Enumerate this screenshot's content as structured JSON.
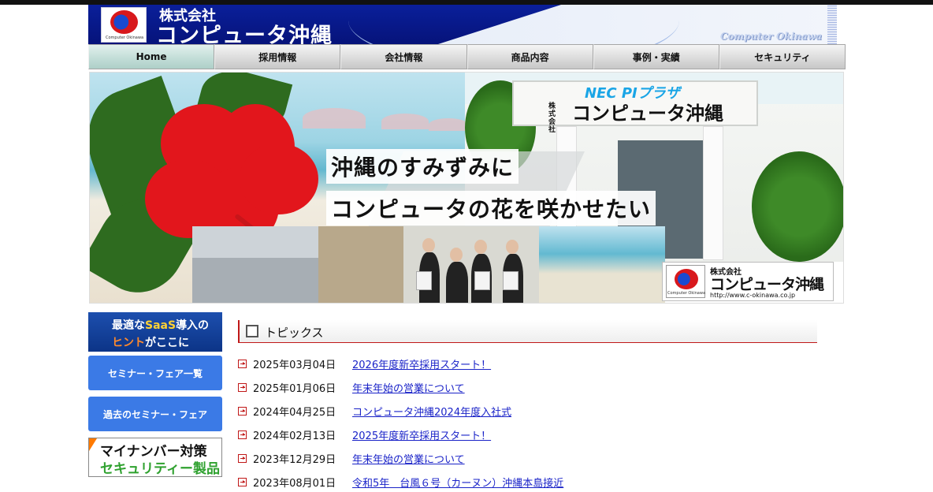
{
  "header": {
    "company_prefix": "株式会社",
    "company_name": "コンピュータ沖縄",
    "english_name": "Computer Okinawa",
    "logo_caption": "Computer Okinawa"
  },
  "nav": {
    "items": [
      {
        "label": "Home",
        "active": true
      },
      {
        "label": "採用情報"
      },
      {
        "label": "会社情報"
      },
      {
        "label": "商品内容"
      },
      {
        "label": "事例・実績"
      },
      {
        "label": "セキュリティ"
      }
    ]
  },
  "hero": {
    "sign_plaza": "NEC PIプラザ",
    "sign_small": "株式会社",
    "sign_name": "コンピュータ沖縄",
    "catch_line1": "沖縄のすみずみに",
    "catch_line2": "コンピュータの花を咲かせたい",
    "corner_prefix": "株式会社",
    "corner_name": "コンピュータ沖縄",
    "corner_url": "http://www.c-okinawa.co.jp",
    "corner_caption": "Computer Okinawa"
  },
  "side": {
    "saas_line1_a": "最適な",
    "saas_line1_b": "SaaS",
    "saas_line1_c": "導入の",
    "saas_line2_a": "ヒント",
    "saas_line2_b": "がここに",
    "seminar_list": "セミナー・フェア一覧",
    "past_seminar": "過去のセミナー・フェア",
    "mynumber_line1": "マイナンバー対策",
    "mynumber_line2": "セキュリティー製品"
  },
  "topics": {
    "title": "トピックス",
    "items": [
      {
        "date": "2025年03月04日",
        "text": "2026年度新卒採用スタート！"
      },
      {
        "date": "2025年01月06日",
        "text": "年末年始の営業について"
      },
      {
        "date": "2024年04月25日",
        "text": "コンピュータ沖縄2024年度入社式"
      },
      {
        "date": "2024年02月13日",
        "text": "2025年度新卒採用スタート！"
      },
      {
        "date": "2023年12月29日",
        "text": "年末年始の営業について"
      },
      {
        "date": "2023年08月01日",
        "text": "令和5年　台風６号（カーヌン）沖縄本島接近"
      }
    ]
  }
}
